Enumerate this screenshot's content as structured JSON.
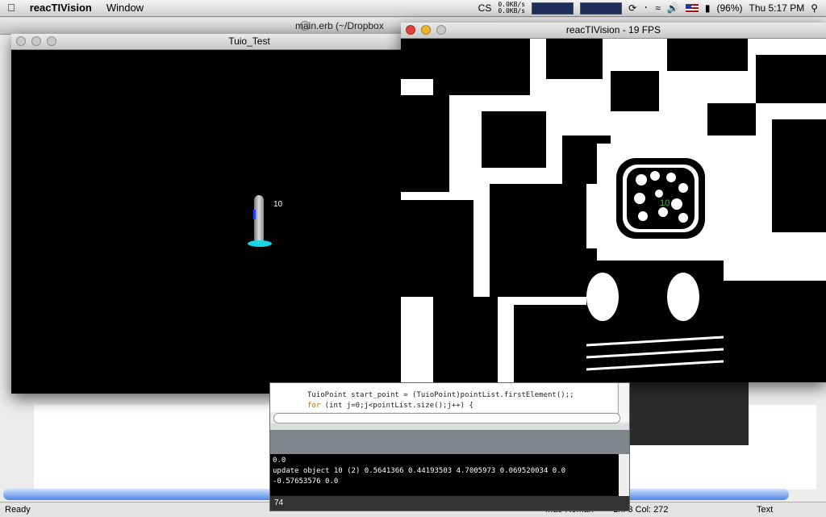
{
  "menubar": {
    "apple": "",
    "app": "reacTIVision",
    "window": "Window",
    "cs": "CS",
    "net_up": "0.0KB/s",
    "net_down": "0.0KB/s",
    "battery": "(96%)",
    "clock": "Thu 5:17 PM"
  },
  "editor": {
    "title": "main.erb (~/Dropbox",
    "status_ready": "Ready",
    "status_encoding": "Mac-Roman",
    "status_pos": "Ln: 3 Col: 272",
    "status_mode": "Text"
  },
  "tuio": {
    "title": "Tuio_Test",
    "marker_id": "10"
  },
  "reac": {
    "title": "reacTIVision - 19 FPS",
    "fiducial_id": "10"
  },
  "console": {
    "code_line1": "TuioPoint start_point = (TuioPoint)pointList.firstElement();;",
    "code_line2_kw": "for",
    "code_line2_rest": " (int j=0;j<pointList.size();j++) {",
    "out_lines": [
      "0.0",
      "update object 10 (2) 0.5641366 0.44193503 4.7005973 0.069520034 0.0",
      "-0.57653576 0.0"
    ],
    "footer": "74"
  }
}
